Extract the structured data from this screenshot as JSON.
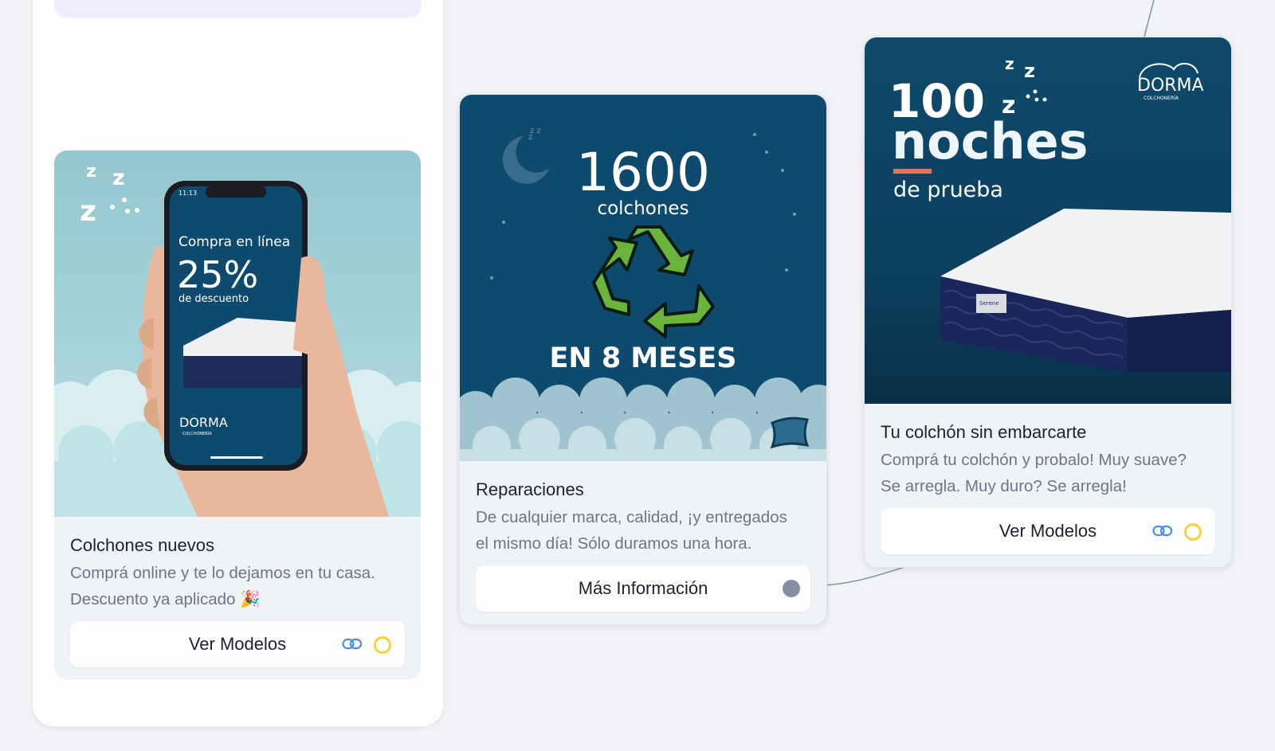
{
  "cards": [
    {
      "id": "colchones-nuevos",
      "title": "Colchones nuevos",
      "desc_line1": "Comprá online y te lo dejamos en tu casa.",
      "desc_line2": "Descuento ya aplicado",
      "desc_emoji": "🎉",
      "button_label": "Ver Modelos",
      "image": {
        "phone_time": "11:13",
        "headline": "Compra en línea",
        "discount": "25%",
        "discount_sub": "de descuento",
        "brand": "DORMA",
        "brand_sub": "COLCHONERÍA"
      }
    },
    {
      "id": "reparaciones",
      "title": "Reparaciones",
      "desc_line1": "De cualquier marca, calidad, ¡y entregados",
      "desc_line2": "el mismo día! Sólo duramos una hora.",
      "button_label": "Más Información",
      "image": {
        "big_number": "1600",
        "sub": "colchones",
        "bottom": "EN 8 MESES"
      }
    },
    {
      "id": "tu-colchon",
      "title": "Tu colchón sin embarcarte",
      "desc_line1": "Comprá tu colchón y probalo! Muy suave?",
      "desc_line2": "Se arregla. Muy duro? Se arregla!",
      "button_label": "Ver Modelos",
      "image": {
        "big_number": "100",
        "headline": "noches",
        "sub": "de prueba",
        "brand": "DORMA",
        "brand_sub": "COLCHONERÍA",
        "tag": "Serene"
      }
    }
  ],
  "colors": {
    "canvas": "#f1f3f7",
    "link_icon": "#4a90e2",
    "status_ring": "#f6d03f",
    "port_dot": "#858fa4",
    "night_blue": "#0e4a6e",
    "sky_teal": "#a2d0d6"
  },
  "icons": [
    "link-icon",
    "status-ring-icon",
    "recycle-icon",
    "moon-icon",
    "pillow-icon",
    "zzz-icon",
    "party-popper-icon"
  ]
}
